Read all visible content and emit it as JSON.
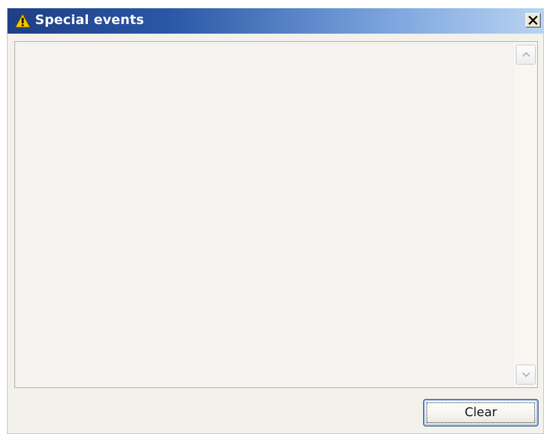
{
  "window": {
    "title": "Special events",
    "title_icon": "warning-icon",
    "close_icon": "close-icon"
  },
  "log": {
    "entries": []
  },
  "scrollbar": {
    "up_icon": "chevron-up-icon",
    "down_icon": "chevron-down-icon"
  },
  "actions": {
    "clear_label": "Clear"
  },
  "colors": {
    "titlebar_start": "#1e3f86",
    "titlebar_end": "#b9d4f2",
    "warning_yellow": "#f5c400",
    "panel_bg": "#f3f1ec"
  }
}
